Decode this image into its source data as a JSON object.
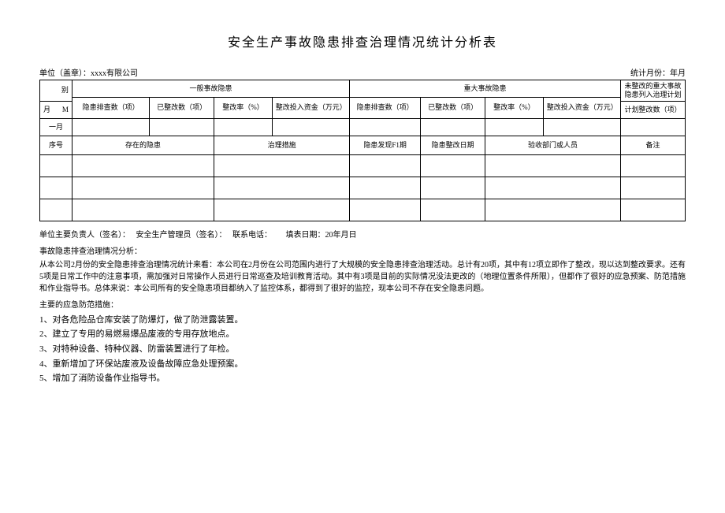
{
  "title": "安全生产事故隐患排查治理情况统计分析表",
  "header": {
    "unit_label": "单位（盖章）：xxxx有限公司",
    "month_label": "统计月份：年月"
  },
  "table1": {
    "corner_top": "别",
    "corner_bottom_left": "月",
    "corner_bottom_right": "M",
    "cat_general": "一般事故隐患",
    "cat_major": "重大事故隐患",
    "not_rectified": "未整改的重大事故隐患列入治理计划",
    "plan_count": "计划整改数（项）",
    "cols_general": {
      "inspect": "隐患排查数（项）",
      "rectified": "已整改数（项）",
      "rate": "整改率（%）",
      "invest": "整改投入资金（万元）"
    },
    "cols_major": {
      "inspect": "隐患排查数（项）",
      "rectified": "已整改数（项）",
      "rate": "整改率（%）",
      "invest": "整改投入资金（万元）"
    },
    "row_month": "一月"
  },
  "table2": {
    "headers": {
      "seq": "序号",
      "hazard": "存在的隐患",
      "measure": "治理措施",
      "found": "隐患发现F1期",
      "rectify_date": "隐患整改日期",
      "acceptor": "验收部门或人员",
      "remark": "备注"
    }
  },
  "signature": {
    "responsible": "单位主要负责人（签名）：",
    "manager": "安全生产管理员（签名）：",
    "phone": "联系电话：",
    "fill_date": "填表日期：20年月日"
  },
  "analysis": {
    "title": "事故隐患排查治理情况分析：",
    "body": "从本公司2月份的安全隐患排查治理情况统计来看：本公司在2月份在公司范围内进行了大规模的安全隐患排查治理活动。总计有20项，其中有12项立即作了整改，现以达到整改要求。还有5项是日常工作中的注意事项，需加强对日常操作人员进行日常巡查及培训教育活动。其中有3项是目前的实际情况没法更改的（地理位置条件所限），但都作了很好的应急预案、防范措施和作业指导书。总体来说：本公司所有的安全隐患项目都纳入了监控体系，都得到了很好的监控，现本公司不存在安全隐患问题。"
  },
  "measures": {
    "title": "主要的应急防范措施：",
    "items": [
      "1、对各危险品仓库安装了防爆灯，做了防泄露装置。",
      "2、建立了专用的易燃易爆品废液的专用存放地点。",
      "3、对特种设备、特种仪器、防雷装置进行了年检。",
      "4、重新增加了环保站废液及设备故障应急处理预案。",
      "5、增加了消防设备作业指导书。"
    ]
  }
}
